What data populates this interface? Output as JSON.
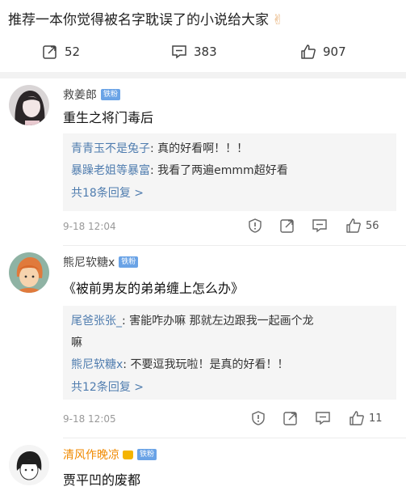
{
  "post": {
    "title": "推荐一本你觉得被名字耽误了的小说给大家",
    "emoji": "✌",
    "reposts": "52",
    "comments": "383",
    "likes": "907"
  },
  "comments": [
    {
      "user": "救姜郎",
      "badge": "铁粉",
      "text": "重生之将门毒后",
      "replies": [
        {
          "user": "青青玉不是兔子",
          "text": "真的好看啊！！！"
        },
        {
          "user": "暴躁老姐等暴富",
          "text": "我看了两遍emmm超好看"
        }
      ],
      "more": "共18条回复 >",
      "time": "9-18 12:04",
      "likes": "56"
    },
    {
      "user": "熊尼软糖x",
      "badge": "铁粉",
      "text": "《被前男友的弟弟缠上怎么办》",
      "replies": [
        {
          "user": "尾爸张张_",
          "text": "害能咋办嘛 那就左边跟我一起画个龙",
          "cont": "嘛"
        },
        {
          "user": "熊尼软糖x",
          "text": "不要逗我玩啦！是真的好看！！"
        }
      ],
      "more": "共12条回复 >",
      "time": "9-18 12:05",
      "likes": "11"
    },
    {
      "user": "清风作晚凉",
      "badge": "铁粉",
      "text": "贾平凹的废都"
    }
  ],
  "colors": {
    "link": "#507daf",
    "vip_name": "#f08a00",
    "badge": "#6aa3e6"
  }
}
